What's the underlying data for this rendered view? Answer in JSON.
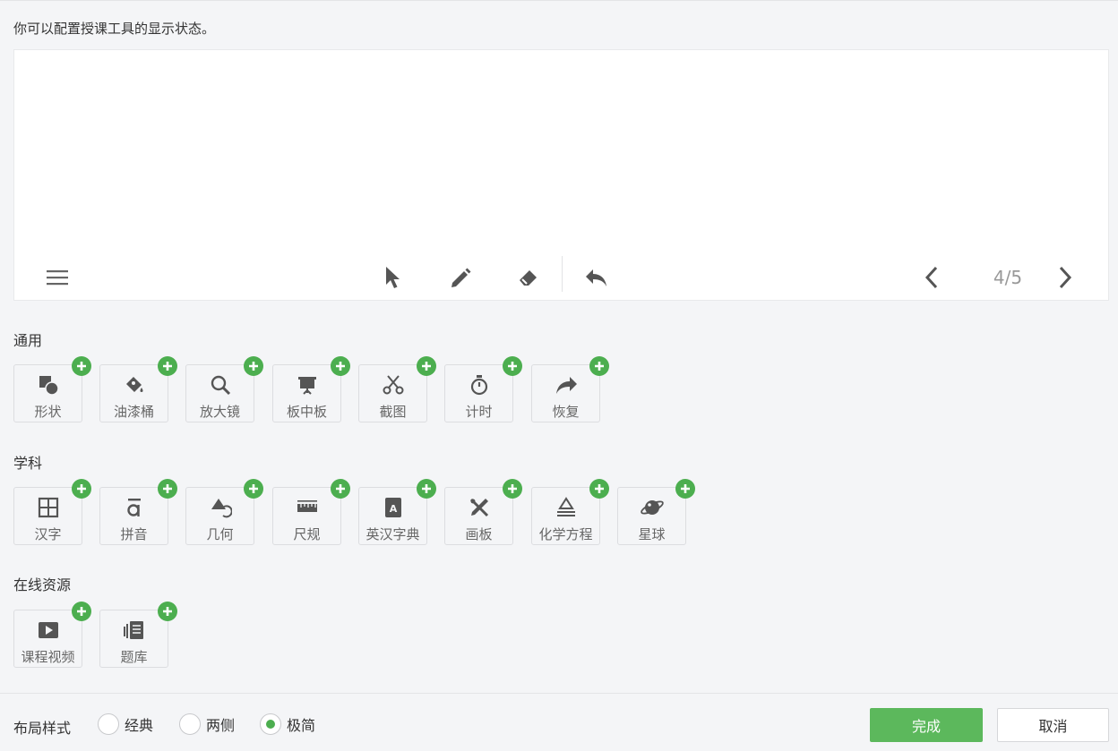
{
  "intro_text": "你可以配置授课工具的显示状态。",
  "preview": {
    "toolbar_icons": [
      "menu-icon",
      "pointer-icon",
      "pen-icon",
      "eraser-icon",
      "undo-icon"
    ],
    "page_indicator": "4/5"
  },
  "sections": {
    "general": {
      "title": "通用",
      "tools": [
        {
          "label": "形状",
          "icon": "shape-icon"
        },
        {
          "label": "油漆桶",
          "icon": "paint-bucket-icon"
        },
        {
          "label": "放大镜",
          "icon": "magnifier-icon"
        },
        {
          "label": "板中板",
          "icon": "board-icon"
        },
        {
          "label": "截图",
          "icon": "scissors-icon"
        },
        {
          "label": "计时",
          "icon": "stopwatch-icon"
        },
        {
          "label": "恢复",
          "icon": "redo-icon"
        }
      ]
    },
    "subject": {
      "title": "学科",
      "tools": [
        {
          "label": "汉字",
          "icon": "hanzi-grid-icon"
        },
        {
          "label": "拼音",
          "icon": "pinyin-icon"
        },
        {
          "label": "几何",
          "icon": "geometry-icon"
        },
        {
          "label": "尺规",
          "icon": "ruler-icon"
        },
        {
          "label": "英汉字典",
          "icon": "dictionary-icon"
        },
        {
          "label": "画板",
          "icon": "drawing-board-icon"
        },
        {
          "label": "化学方程",
          "icon": "chemistry-icon"
        },
        {
          "label": "星球",
          "icon": "planet-icon"
        }
      ]
    },
    "online": {
      "title": "在线资源",
      "tools": [
        {
          "label": "课程视频",
          "icon": "video-icon"
        },
        {
          "label": "题库",
          "icon": "question-bank-icon"
        }
      ]
    }
  },
  "layout_style": {
    "label": "布局样式",
    "options": [
      "经典",
      "两侧",
      "极简"
    ],
    "selected": "极简"
  },
  "buttons": {
    "done": "完成",
    "cancel": "取消"
  },
  "colors": {
    "accent_green": "#5cb85c",
    "plus_green": "#4cae4f",
    "icon_gray": "#555555"
  }
}
